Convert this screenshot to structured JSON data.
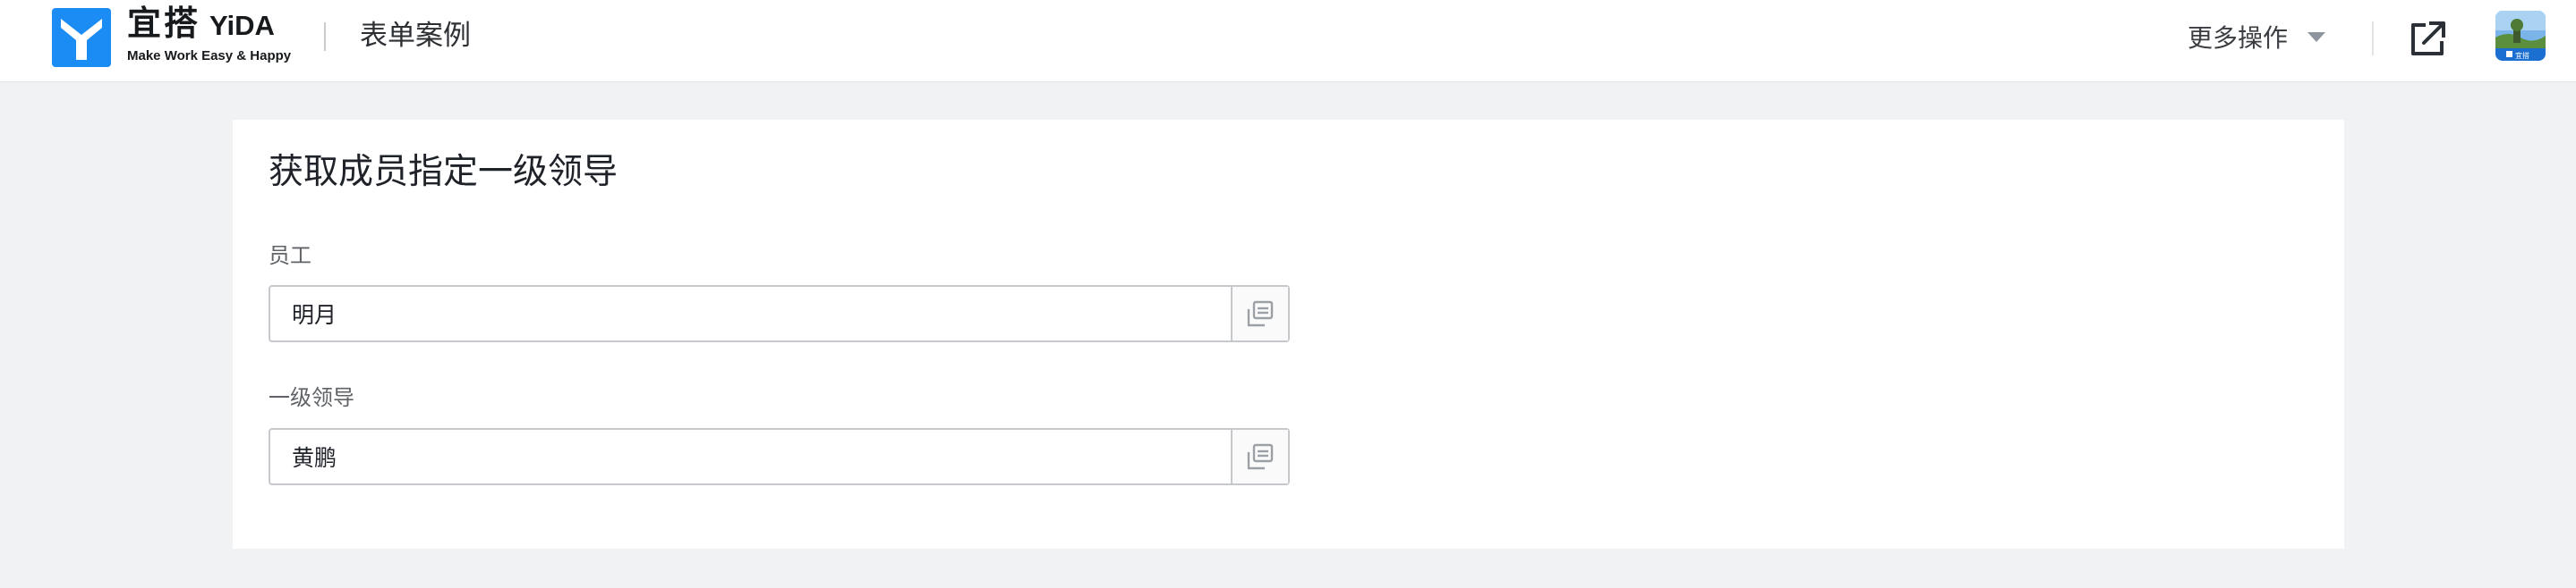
{
  "header": {
    "brand": {
      "name_cn": "宜搭",
      "name_en": "YiDA",
      "slogan": "Make Work Easy & Happy",
      "icon": "yida-logo-icon",
      "color": "#1b8cf3"
    },
    "app_name": "表单案例",
    "more_actions_label": "更多操作",
    "open_new_window_icon": "external-link-icon",
    "avatar_badge": "宜搭"
  },
  "form": {
    "title": "获取成员指定一级领导",
    "fields": [
      {
        "label": "员工",
        "value": "明月",
        "picker_icon": "member-select-icon"
      },
      {
        "label": "一级领导",
        "value": "黄鹏",
        "picker_icon": "member-select-icon"
      }
    ]
  },
  "colors": {
    "page_background": "#f1f2f3",
    "card_background": "#ffffff",
    "field_border": "#c5c8cd"
  }
}
